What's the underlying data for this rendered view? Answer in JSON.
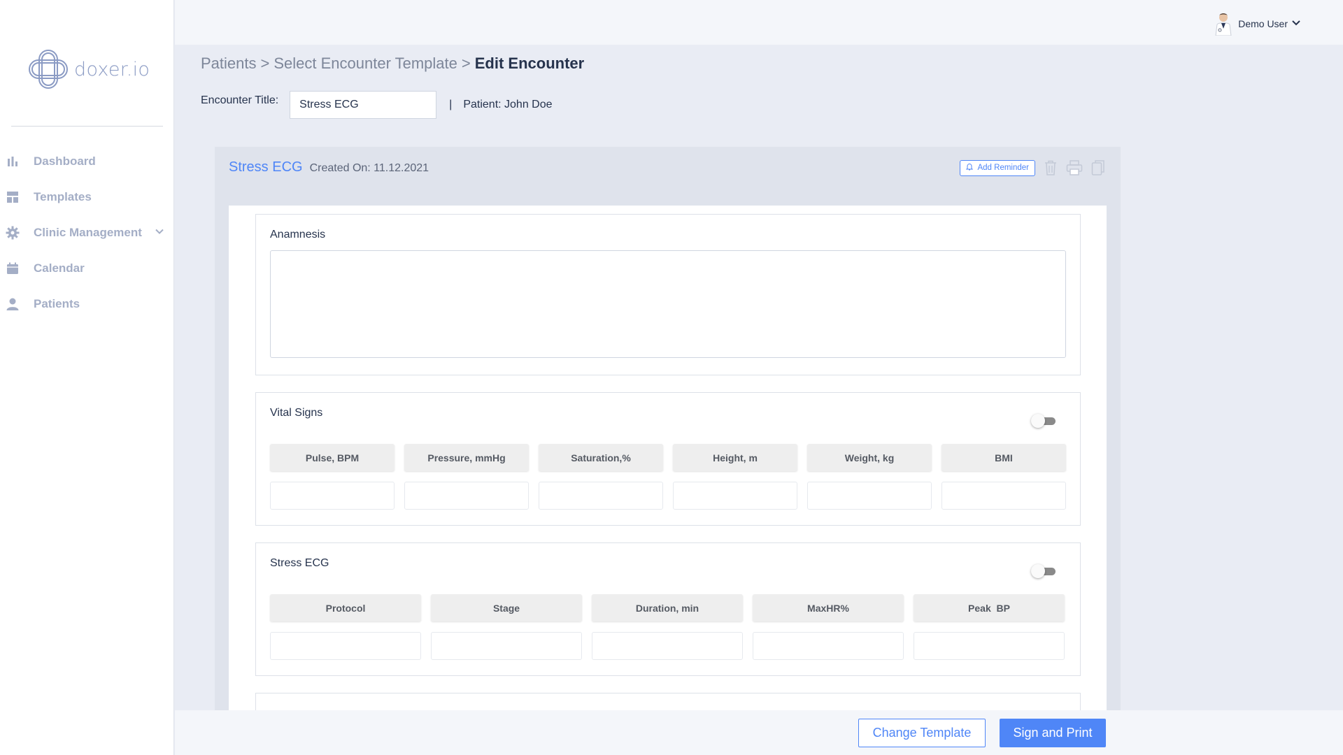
{
  "brand": {
    "name": "doxer.io"
  },
  "sidebar": {
    "items": [
      {
        "label": "Dashboard",
        "icon": "bar-chart-icon"
      },
      {
        "label": "Templates",
        "icon": "templates-icon"
      },
      {
        "label": "Clinic Management",
        "icon": "gear-icon",
        "has_submenu": true
      },
      {
        "label": "Calendar",
        "icon": "calendar-icon"
      },
      {
        "label": "Patients",
        "icon": "person-icon"
      }
    ]
  },
  "topbar": {
    "user_name": "Demo User"
  },
  "breadcrumb": {
    "items": [
      "Patients",
      ">",
      "Select Encounter Template",
      ">"
    ],
    "current": "Edit Encounter"
  },
  "encounter": {
    "title_label": "Encounter Title:",
    "title_value": "Stress ECG",
    "separator": "|",
    "patient": "Patient: John Doe",
    "name": "Stress ECG",
    "created_on": "Created On: 11.12.2021",
    "add_reminder": "Add Reminder"
  },
  "sections": {
    "anamnesis": {
      "title": "Anamnesis"
    },
    "vital_signs": {
      "title": "Vital Signs",
      "columns": [
        "Pulse, BPM",
        "Pressure, mmHg",
        "Saturation,%",
        "Height, m",
        "Weight, kg",
        "BMI"
      ]
    },
    "stress_ecg": {
      "title": "Stress ECG",
      "columns": [
        "Protocol",
        "Stage",
        "Duration, min",
        "MaxHR%",
        "Peak  BP"
      ]
    }
  },
  "footer": {
    "change_template": "Change Template",
    "sign_print": "Sign and Print"
  },
  "colors": {
    "accent": "#4f86f7",
    "sidebar_text": "#a4aec6",
    "background": "#e9ecf4"
  }
}
